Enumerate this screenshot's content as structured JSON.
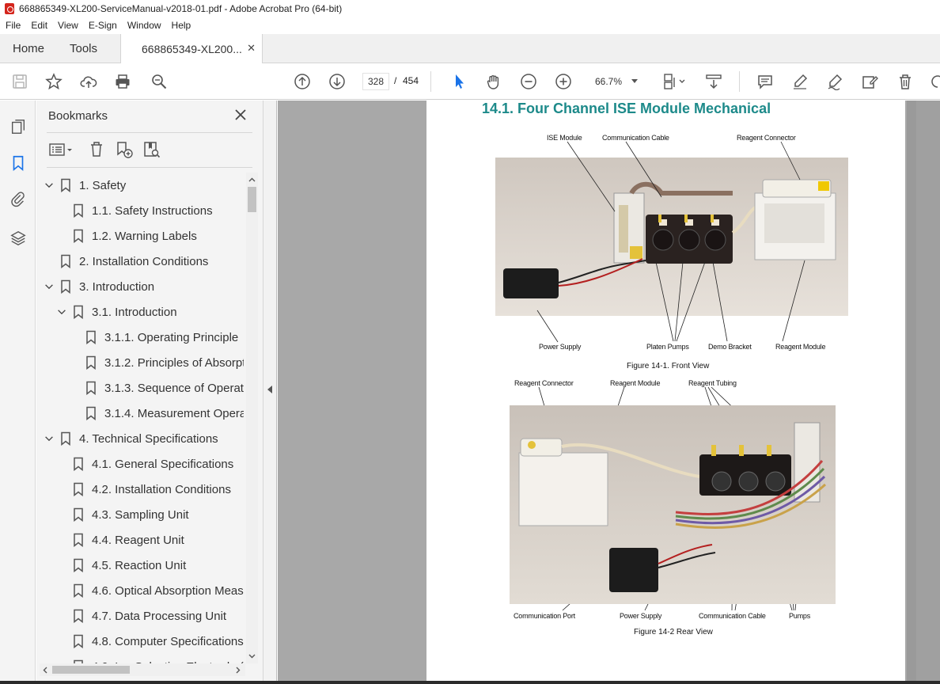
{
  "window": {
    "title": "668865349-XL200-ServiceManual-v2018-01.pdf - Adobe Acrobat Pro (64-bit)"
  },
  "menu": [
    "File",
    "Edit",
    "View",
    "E-Sign",
    "Window",
    "Help"
  ],
  "tabs": {
    "home": "Home",
    "tools": "Tools",
    "document": "668865349-XL200..."
  },
  "toolbar": {
    "current_page": "328",
    "separator": "/",
    "total_pages": "454",
    "zoom": "66.7%"
  },
  "bookmarks": {
    "title": "Bookmarks",
    "items": [
      {
        "label": "1.  Safety",
        "level": 0,
        "expanded": true
      },
      {
        "label": "1.1. Safety Instructions",
        "level": 1,
        "expanded": null
      },
      {
        "label": "1.2. Warning Labels",
        "level": 1,
        "expanded": null
      },
      {
        "label": "2.  Installation Conditions",
        "level": 0,
        "expanded": null
      },
      {
        "label": "3.  Introduction",
        "level": 0,
        "expanded": true
      },
      {
        "label": "3.1. Introduction",
        "level": 1,
        "expanded": true
      },
      {
        "label": "3.1.1. Operating Principle",
        "level": 2,
        "expanded": null
      },
      {
        "label": "3.1.2. Principles of Absorpt",
        "level": 2,
        "expanded": null
      },
      {
        "label": "3.1.3. Sequence of Operatio",
        "level": 2,
        "expanded": null
      },
      {
        "label": "3.1.4. Measurement Operat",
        "level": 2,
        "expanded": null
      },
      {
        "label": "4.  Technical Specifications",
        "level": 0,
        "expanded": true
      },
      {
        "label": "4.1. General Specifications",
        "level": 1,
        "expanded": null
      },
      {
        "label": "4.2. Installation Conditions",
        "level": 1,
        "expanded": null
      },
      {
        "label": "4.3. Sampling Unit",
        "level": 1,
        "expanded": null
      },
      {
        "label": "4.4. Reagent Unit",
        "level": 1,
        "expanded": null
      },
      {
        "label": "4.5. Reaction Unit",
        "level": 1,
        "expanded": null
      },
      {
        "label": "4.6. Optical Absorption Meas",
        "level": 1,
        "expanded": null
      },
      {
        "label": "4.7. Data Processing Unit",
        "level": 1,
        "expanded": null
      },
      {
        "label": "4.8. Computer Specifications",
        "level": 1,
        "expanded": null
      },
      {
        "label": "4.9. Ion Selective Electrode (I",
        "level": 1,
        "expanded": null
      }
    ]
  },
  "page": {
    "heading": "14.1. Four Channel ISE Module Mechanical",
    "figure1": {
      "labels": {
        "ise_module": "ISE Module",
        "communication_cable": "Communication Cable",
        "reagent_connector": "Reagent Connector",
        "power_supply": "Power Supply",
        "platen_pumps": "Platen Pumps",
        "demo_bracket": "Demo Bracket",
        "reagent_module": "Reagent Module"
      },
      "caption": "Figure 14-1. Front View"
    },
    "figure2": {
      "labels": {
        "reagent_connector": "Reagent Connector",
        "reagent_module": "Reagent Module",
        "reagent_tubing": "Reagent Tubing",
        "communication_port": "Communication Port",
        "power_supply": "Power Supply",
        "communication_cable": "Communication Cable",
        "pumps": "Pumps"
      },
      "caption": "Figure 14-2 Rear View"
    }
  },
  "colors": {
    "heading": "#1d8a8a",
    "active_icon": "#1a73e8",
    "pdf_red": "#d4251c"
  }
}
